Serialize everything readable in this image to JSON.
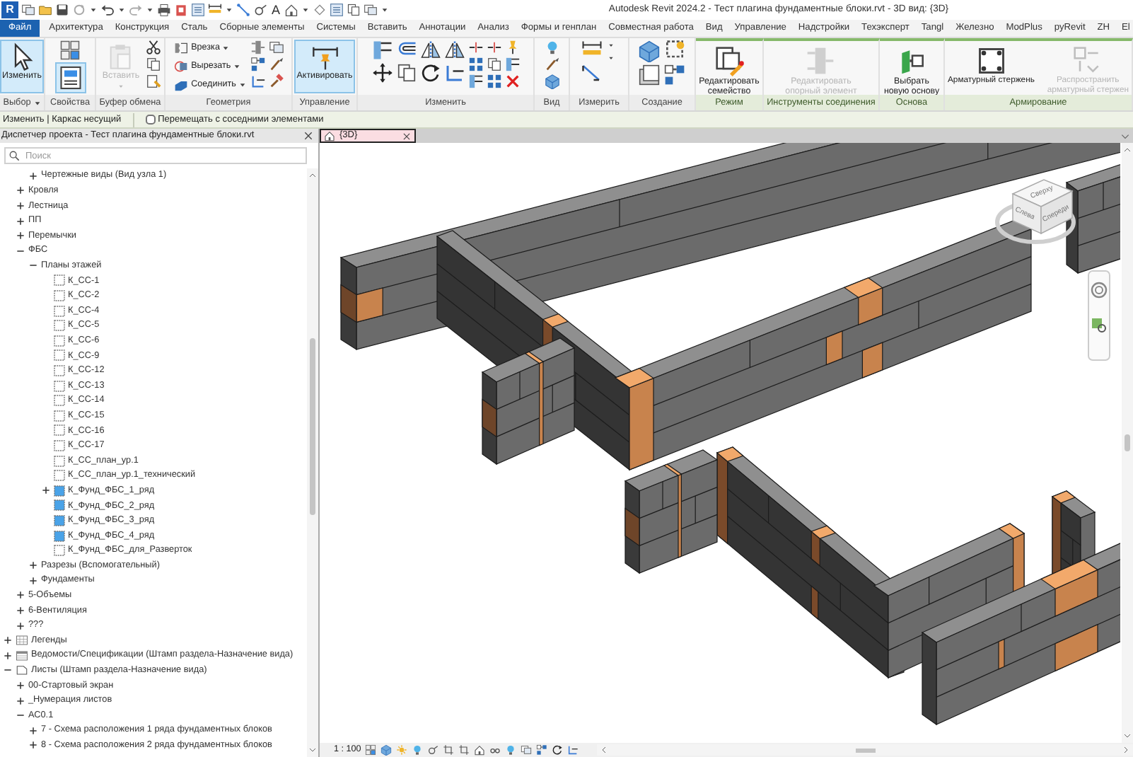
{
  "window": {
    "app_logo": "R",
    "title": "Autodesk Revit 2024.2 - Тест плагина фундаментные блоки.rvt - 3D вид: {3D}",
    "text_tool": "A"
  },
  "ribbon_tabs": [
    {
      "label": "Файл",
      "kind": "file",
      "selected": false
    },
    {
      "label": "Архитектура",
      "kind": "tab",
      "selected": false
    },
    {
      "label": "Конструкция",
      "kind": "tab",
      "selected": false
    },
    {
      "label": "Сталь",
      "kind": "tab",
      "selected": false
    },
    {
      "label": "Сборные элементы",
      "kind": "tab",
      "selected": false
    },
    {
      "label": "Системы",
      "kind": "tab",
      "selected": false
    },
    {
      "label": "Вставить",
      "kind": "tab",
      "selected": false
    },
    {
      "label": "Аннотации",
      "kind": "tab",
      "selected": false
    },
    {
      "label": "Анализ",
      "kind": "tab",
      "selected": false
    },
    {
      "label": "Формы и генплан",
      "kind": "tab",
      "selected": false
    },
    {
      "label": "Совместная работа",
      "kind": "tab",
      "selected": false
    },
    {
      "label": "Вид",
      "kind": "tab",
      "selected": false
    },
    {
      "label": "Управление",
      "kind": "tab",
      "selected": false
    },
    {
      "label": "Надстройки",
      "kind": "tab",
      "selected": false
    },
    {
      "label": "Техэксперт",
      "kind": "tab",
      "selected": false
    },
    {
      "label": "Tangl",
      "kind": "tab",
      "selected": false
    },
    {
      "label": "Железно",
      "kind": "tab",
      "selected": false
    },
    {
      "label": "ModPlus",
      "kind": "tab",
      "selected": false
    },
    {
      "label": "pyRevit",
      "kind": "tab",
      "selected": false
    },
    {
      "label": "ZH",
      "kind": "tab",
      "selected": false
    },
    {
      "label": "El",
      "kind": "tab",
      "selected": false
    }
  ],
  "ribbon_panels": [
    {
      "label": "Выбор",
      "dropdown": true,
      "contextual": false,
      "buttons": [
        {
          "label": "Изменить",
          "selected": true,
          "disabled": false,
          "dropdown": false
        }
      ]
    },
    {
      "label": "Свойства",
      "contextual": false,
      "buttons": [
        {
          "selected": true,
          "disabled": false,
          "dropdown": false
        }
      ]
    },
    {
      "label": "Буфер обмена",
      "contextual": false,
      "buttons": [
        {
          "label": "Вставить",
          "selected": false,
          "disabled": true,
          "dropdown": true
        }
      ]
    },
    {
      "label": "Геометрия",
      "contextual": false,
      "buttons": [
        {
          "label": "Врезка",
          "selected": false,
          "disabled": false,
          "dropdown": true
        },
        {
          "label": "Вырезать",
          "selected": false,
          "disabled": false,
          "dropdown": true
        },
        {
          "label": "Соединить",
          "selected": false,
          "disabled": false,
          "dropdown": true
        }
      ]
    },
    {
      "label": "Управление",
      "contextual": false,
      "buttons": [
        {
          "label": "Активировать",
          "selected": true,
          "disabled": false,
          "dropdown": false
        }
      ]
    },
    {
      "label": "Изменить",
      "contextual": false
    },
    {
      "label": "Вид",
      "contextual": false
    },
    {
      "label": "Измерить",
      "contextual": false
    },
    {
      "label": "Создание",
      "contextual": false
    },
    {
      "label": "Режим",
      "contextual": true,
      "buttons": [
        {
          "label": "Редактировать\nсемейство",
          "selected": false,
          "disabled": false,
          "dropdown": false
        }
      ]
    },
    {
      "label": "Инструменты соединения",
      "contextual": true,
      "buttons": [
        {
          "label": "Редактировать\nопорный элемент",
          "selected": false,
          "disabled": true,
          "dropdown": false
        }
      ]
    },
    {
      "label": "Основа",
      "contextual": true,
      "buttons": [
        {
          "label": "Выбрать\nновую основу",
          "selected": false,
          "disabled": false,
          "dropdown": false
        }
      ]
    },
    {
      "label": "Армирование",
      "contextual": true,
      "buttons": [
        {
          "label": "Арматурный стержень",
          "selected": false,
          "disabled": false,
          "dropdown": false
        },
        {
          "label": "Распространить\nарматурный стержен",
          "selected": false,
          "disabled": true,
          "dropdown": false
        }
      ]
    }
  ],
  "options_bar": {
    "context": "Изменить | Каркас несущий",
    "checkbox": {
      "label": "Перемещать с соседними элементами",
      "checked": false
    }
  },
  "browser": {
    "title": "Диспетчер проекта - Тест плагина фундаментные блоки.rvt",
    "search_placeholder": "Поиск",
    "tree": [
      {
        "children": [
          {
            "children": [
              {
                "label": "Чертежные виды (Вид узла 1)",
                "expanded": false
              }
            ]
          },
          {
            "label": "Кровля",
            "expanded": false
          },
          {
            "label": "Лестница",
            "expanded": false
          },
          {
            "label": "ПП",
            "expanded": false
          },
          {
            "label": "Перемычки",
            "expanded": false
          },
          {
            "label": "ФБС",
            "expanded": true,
            "children": [
              {
                "label": "Планы этажей",
                "expanded": true,
                "children": [
                  {
                    "label": "К_СС-1",
                    "kind": "plan",
                    "open": false
                  },
                  {
                    "label": "К_СС-2",
                    "kind": "plan",
                    "open": false
                  },
                  {
                    "label": "К_СС-4",
                    "kind": "plan",
                    "open": false
                  },
                  {
                    "label": "К_СС-5",
                    "kind": "plan",
                    "open": false
                  },
                  {
                    "label": "К_СС-6",
                    "kind": "plan",
                    "open": false
                  },
                  {
                    "label": "К_СС-9",
                    "kind": "plan",
                    "open": false
                  },
                  {
                    "label": "К_СС-12",
                    "kind": "plan",
                    "open": false
                  },
                  {
                    "label": "К_СС-13",
                    "kind": "plan",
                    "open": false
                  },
                  {
                    "label": "К_СС-14",
                    "kind": "plan",
                    "open": false
                  },
                  {
                    "label": "К_СС-15",
                    "kind": "plan",
                    "open": false
                  },
                  {
                    "label": "К_СС-16",
                    "kind": "plan",
                    "open": false
                  },
                  {
                    "label": "К_СС-17",
                    "kind": "plan",
                    "open": false
                  },
                  {
                    "label": "К_СС_план_ур.1",
                    "kind": "plan",
                    "open": false
                  },
                  {
                    "label": "К_СС_план_ур.1_технический",
                    "kind": "plan",
                    "open": false
                  },
                  {
                    "label": "К_Фунд_ФБС_1_ряд",
                    "kind": "plan",
                    "open": true,
                    "expanded": false
                  },
                  {
                    "label": "К_Фунд_ФБС_2_ряд",
                    "kind": "plan",
                    "open": true
                  },
                  {
                    "label": "К_Фунд_ФБС_3_ряд",
                    "kind": "plan",
                    "open": true
                  },
                  {
                    "label": "К_Фунд_ФБС_4_ряд",
                    "kind": "plan",
                    "open": true
                  },
                  {
                    "label": "К_Фунд_ФБС_для_Разверток",
                    "kind": "plan",
                    "open": false
                  }
                ]
              },
              {
                "label": "Разрезы (Вспомогательный)",
                "expanded": false
              },
              {
                "label": "Фундаменты",
                "expanded": false
              }
            ]
          },
          {
            "label": "5-Объемы",
            "expanded": false
          },
          {
            "label": "6-Вентиляция",
            "expanded": false
          },
          {
            "label": "???",
            "expanded": false
          }
        ]
      },
      {
        "label": "Легенды",
        "kind": "legend",
        "expanded": false
      },
      {
        "label": "Ведомости/Спецификации (Штамп раздела-Назначение вида)",
        "kind": "schedule",
        "expanded": false
      },
      {
        "label": "Листы (Штамп раздела-Назначение вида)",
        "kind": "sheet",
        "expanded": true,
        "children": [
          {
            "label": "00-Стартовый экран",
            "expanded": false
          },
          {
            "label": "_Нумерация листов",
            "expanded": false
          },
          {
            "label": "АС0.1",
            "expanded": true,
            "children": [
              {
                "label": "7 - Схема расположения 1 ряда фундаментных блоков",
                "expanded": false
              },
              {
                "label": "8 - Схема расположения 2 ряда фундаментных блоков",
                "expanded": false
              }
            ]
          }
        ]
      }
    ]
  },
  "view": {
    "tab": {
      "label": "{3D}",
      "selected": true
    },
    "view_cube": {
      "faces": [
        "Сверху",
        "Слева",
        "Спереди"
      ]
    },
    "scale": "1 : 100"
  }
}
